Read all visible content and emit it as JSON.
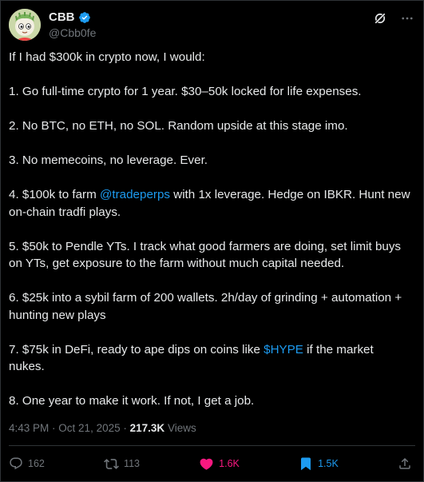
{
  "author": {
    "name": "CBB",
    "handle": "@Cbb0fe"
  },
  "tweet": {
    "paragraphs": [
      {
        "segments": [
          {
            "t": "If I had $300k in crypto now, I would:"
          }
        ]
      },
      {
        "segments": [
          {
            "t": "1. Go full-time crypto for 1 year. $30–50k locked for life expenses."
          }
        ]
      },
      {
        "segments": [
          {
            "t": "2. No BTC, no ETH, no SOL. Random upside at this stage imo."
          }
        ]
      },
      {
        "segments": [
          {
            "t": "3. No memecoins, no leverage. Ever."
          }
        ]
      },
      {
        "segments": [
          {
            "t": "4. $100k to farm "
          },
          {
            "t": "@tradeperps",
            "link": true
          },
          {
            "t": " with 1x leverage. Hedge on IBKR. Hunt new on-chain tradfi plays."
          }
        ]
      },
      {
        "segments": [
          {
            "t": "5. $50k to Pendle YTs. I track what good farmers are doing, set limit buys on YTs, get exposure to the farm without much capital needed."
          }
        ]
      },
      {
        "segments": [
          {
            "t": "6. $25k into a sybil farm of 200 wallets. 2h/day of grinding + automation + hunting new plays"
          }
        ]
      },
      {
        "segments": [
          {
            "t": "7. $75k in DeFi, ready to ape dips on coins like "
          },
          {
            "t": "$HYPE",
            "link": true
          },
          {
            "t": " if the market nukes."
          }
        ]
      },
      {
        "segments": [
          {
            "t": "8. One year to make it work. If not, I get a job."
          }
        ]
      }
    ]
  },
  "meta": {
    "time": "4:43 PM",
    "date": "Oct 21, 2025",
    "views_count": "217.3K",
    "views_label": "Views"
  },
  "actions": {
    "replies": "162",
    "reposts": "113",
    "likes": "1.6K",
    "bookmarks": "1.5K"
  },
  "colors": {
    "background": "#000000",
    "text": "#e7e9ea",
    "muted": "#71767b",
    "link": "#1d9bf0",
    "like": "#f91880",
    "border": "#2f3336"
  }
}
